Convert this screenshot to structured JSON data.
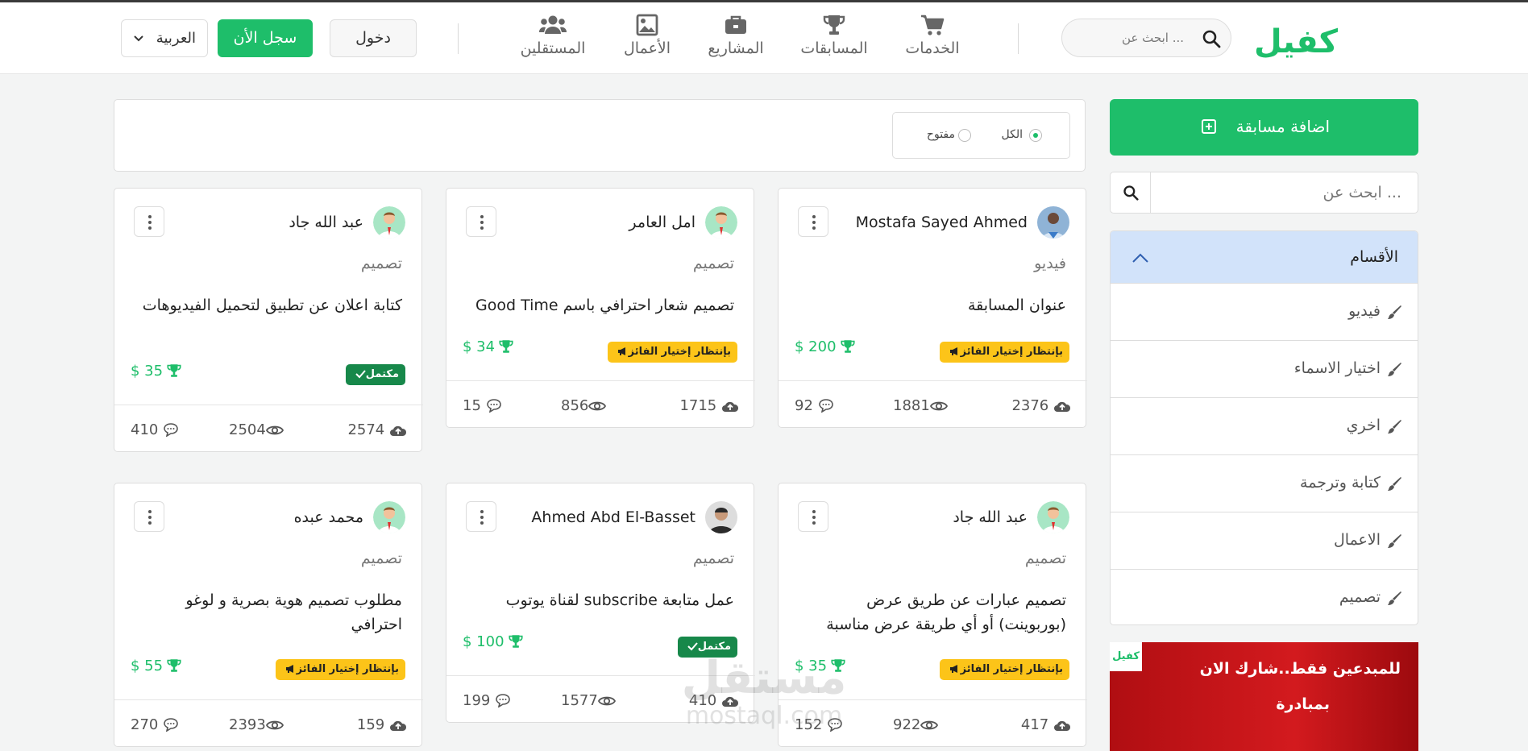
{
  "header": {
    "brand": "كفيل",
    "search_placeholder": "ابحث عن ...",
    "nav": [
      {
        "label": "الخدمات",
        "icon": "cart-icon"
      },
      {
        "label": "المسابقات",
        "icon": "trophy-icon"
      },
      {
        "label": "المشاريع",
        "icon": "briefcase-icon"
      },
      {
        "label": "الأعمال",
        "icon": "image-icon"
      },
      {
        "label": "المستقلين",
        "icon": "users-icon"
      }
    ],
    "login_label": "دخول",
    "signup_label": "سجل الأن",
    "language": "العربية"
  },
  "sidebar": {
    "add_button": "اضافة مسابقة",
    "search_placeholder": "ابحث عن ...",
    "categories_title": "الأقسام",
    "categories": [
      "فيديو",
      "اختيار الاسماء",
      "اخري",
      "كتابة وترجمة",
      "الاعمال",
      "تصميم"
    ],
    "ad": {
      "line1": "للمبدعين فقط..شارك الان",
      "line2": "بمبادرة",
      "logo": "كفيل"
    }
  },
  "filters": {
    "all_label": "الكل",
    "open_label": "مفتوح",
    "selected": "الكل"
  },
  "badges": {
    "waiting": "بإنتظار إختيار الفائز",
    "completed": "مكتمل"
  },
  "colors": {
    "primary": "#1ebe6a",
    "waiting": "#fcc419",
    "completed": "#17884a",
    "categories_header": "#d2e3fa"
  },
  "cards": [
    {
      "user": "Mostafa Sayed Ahmed",
      "category": "فيديو",
      "title": "عنوان المسابقة",
      "prize": "$ 200",
      "status": "waiting",
      "uploads": "2376",
      "views": "1881",
      "comments": "92"
    },
    {
      "user": "امل العامر",
      "category": "تصميم",
      "title": "تصميم شعار احترافي باسم Good Time",
      "prize": "$ 34",
      "status": "waiting",
      "uploads": "1715",
      "views": "856",
      "comments": "15"
    },
    {
      "user": "عبد الله جاد",
      "category": "تصميم",
      "title": "كتابة اعلان عن تطبيق لتحميل الفيديوهات",
      "prize": "$ 35",
      "status": "completed",
      "uploads": "2574",
      "views": "2504",
      "comments": "410"
    },
    {
      "user": "عبد الله جاد",
      "category": "تصميم",
      "title": "تصميم عبارات عن طريق عرض (بوربوينت) أو أي طريقة عرض مناسبة",
      "prize": "$ 35",
      "status": "waiting",
      "uploads": "417",
      "views": "922",
      "comments": "152"
    },
    {
      "user": "Ahmed Abd El-Basset",
      "category": "تصميم",
      "title": "عمل متابعة subscribe لقناة يوتوب",
      "prize": "$ 100",
      "status": "completed",
      "uploads": "410",
      "views": "1577",
      "comments": "199"
    },
    {
      "user": "محمد عبده",
      "category": "تصميم",
      "title": "مطلوب تصميم هوية بصرية و لوغو احترافي",
      "prize": "$ 55",
      "status": "waiting",
      "uploads": "159",
      "views": "2393",
      "comments": "270"
    }
  ],
  "watermark": {
    "line1": "مستقل",
    "line2": "mostaql.com"
  }
}
